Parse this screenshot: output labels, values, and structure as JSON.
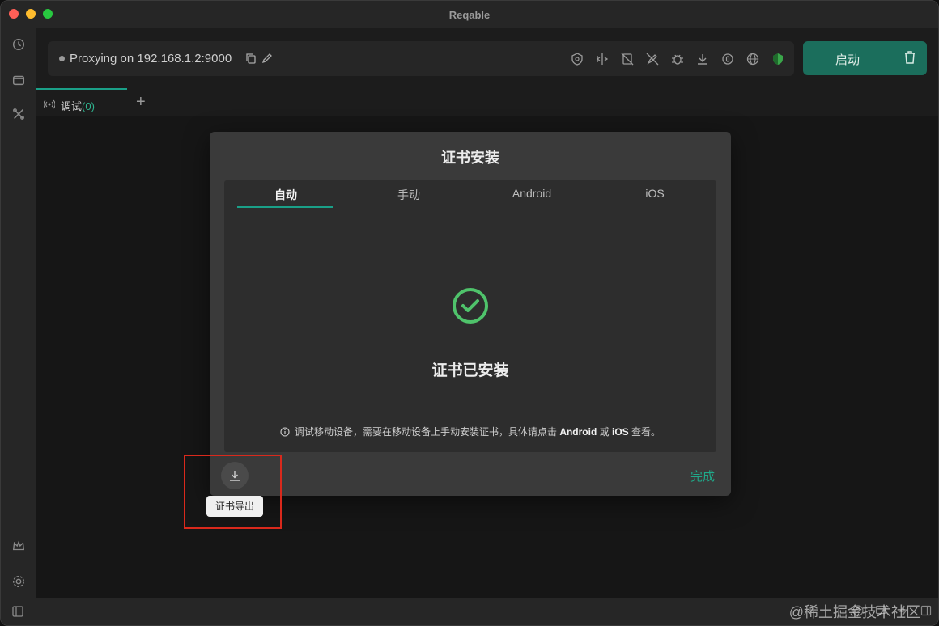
{
  "window": {
    "title": "Reqable"
  },
  "sidebar": {
    "icons": [
      "history-icon",
      "window-icon",
      "tools-icon",
      "crown-icon",
      "settings-icon"
    ]
  },
  "toolbar": {
    "proxy_text": "Proxying on 192.168.1.2:9000",
    "start_label": "启动",
    "tool_icons": [
      "shield-lock-icon",
      "split-icon",
      "no-breakpoint-icon",
      "no-rewrite-icon",
      "bug-icon",
      "download-icon",
      "circle-icon",
      "globe-icon",
      "secure-shield-icon"
    ]
  },
  "tabs": {
    "label": "调试",
    "count": "(0)",
    "add": "+"
  },
  "dialog": {
    "title": "证书安装",
    "tabs": [
      "自动",
      "手动",
      "Android",
      "iOS"
    ],
    "status": "证书已安装",
    "hint_prefix": "调试移动设备，需要在移动设备上手动安装证书，具体请点击",
    "hint_android": "Android",
    "hint_or": "或",
    "hint_ios": "iOS",
    "hint_suffix": "查看。",
    "done_label": "完成"
  },
  "export": {
    "tooltip": "证书导出"
  },
  "statusbar": {
    "watermark": "@稀土掘金技术社区"
  },
  "colors": {
    "accent": "#1aa088",
    "start_button": "#1b6e5c",
    "check": "#4fc36b",
    "highlight": "#d9291c"
  }
}
